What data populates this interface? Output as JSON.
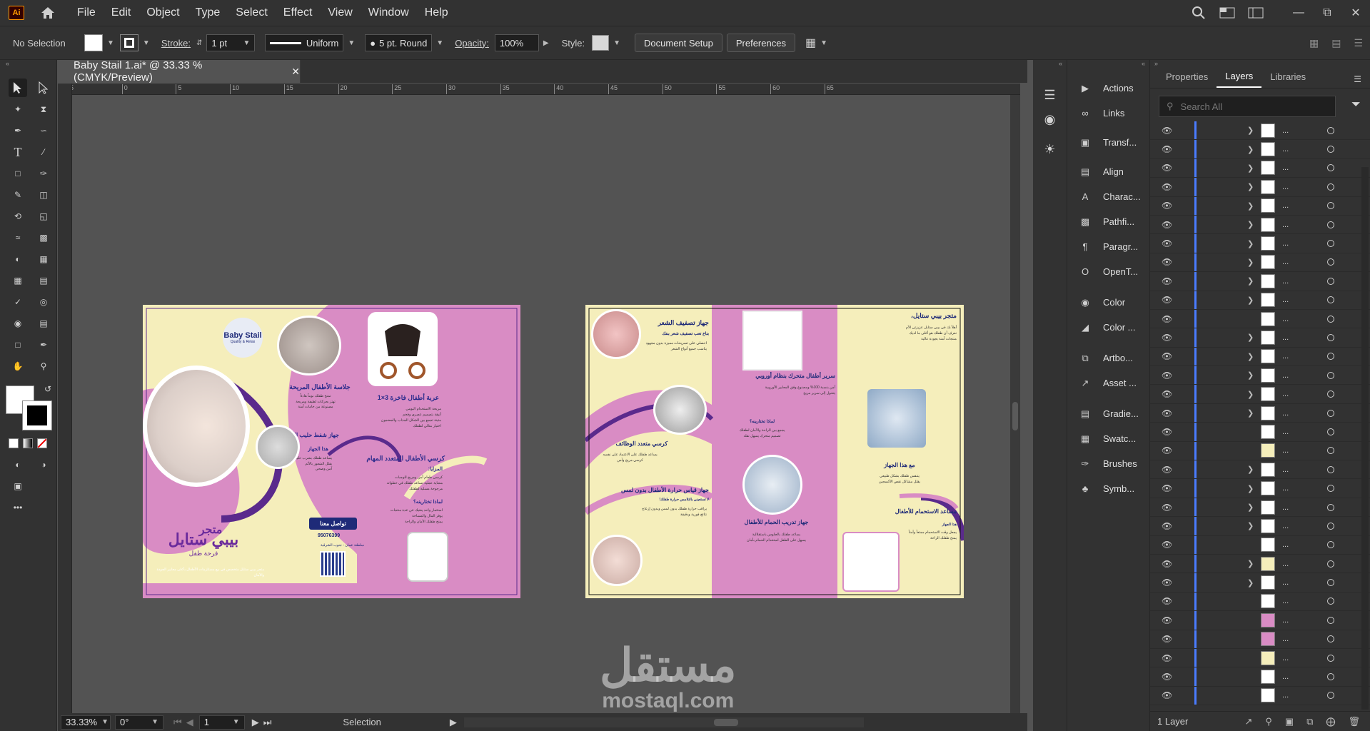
{
  "app": {
    "logo": "Ai"
  },
  "menu": [
    "File",
    "Edit",
    "Object",
    "Type",
    "Select",
    "Effect",
    "View",
    "Window",
    "Help"
  ],
  "control": {
    "selection": "No Selection",
    "stroke_label": "Stroke:",
    "stroke_value": "1 pt",
    "profile": "Uniform",
    "brush": "5 pt. Round",
    "opacity_label": "Opacity:",
    "opacity_value": "100%",
    "style_label": "Style:",
    "doc_setup": "Document Setup",
    "preferences": "Preferences"
  },
  "document": {
    "tab_title": "Baby Stail 1.ai* @ 33.33 % (CMYK/Preview)"
  },
  "ruler": {
    "h_ticks": [
      "5",
      "0",
      "5",
      "10",
      "15",
      "20",
      "25",
      "30",
      "35",
      "40",
      "45",
      "50",
      "55",
      "60",
      "65"
    ]
  },
  "status": {
    "zoom": "33.33%",
    "rotate": "0°",
    "artboard": "1",
    "mode": "Selection"
  },
  "mid_panel": [
    "Actions",
    "Links",
    "Transf...",
    "Align",
    "Charac...",
    "Pathfi...",
    "Paragr...",
    "OpenT...",
    "Color",
    "Color ...",
    "Artbo...",
    "Asset ...",
    "Gradie...",
    "Swatc...",
    "Brushes",
    "Symb..."
  ],
  "layers_panel": {
    "tabs": [
      "Properties",
      "Layers",
      "Libraries"
    ],
    "active_tab": "Layers",
    "search_placeholder": "Search All",
    "row_name": "...",
    "footer": "1 Layer"
  },
  "artboard1": {
    "brand_logo": "Baby Stail",
    "brand_sub": "Quality & Relax",
    "store_title": "متجر",
    "store_name": "بيبي ستايل",
    "store_slogan": "فرحة طفل",
    "s1_title": "جلاسة الأطفال المريحة",
    "s1_text": "تمنح طفلك نوماً هادئاً\nتهتز بحركات لطيفة ومريحة\nمصنوعة من خامات آمنة",
    "s2_title": "عربة أطفال فاخرة 3×1",
    "s2_text": "مريحة الاستخدام اليومي\nأنيقة بتصميم عصري وفخم\nمتينة تجمع بين الشكل الجذاب والمضمون\nاختيار مثالي لطفلك",
    "s3_title": "جهاز شفط حليب الأم الكهربائي:",
    "s3_sub": "هذا الجهاز",
    "s3_text": "يساعد طفلك بشرب حليبك بسهولة\nيقلل الشعور بالألم\nآمن وصحي",
    "s4_title": "كرسي الأطفال المتعدد المهام",
    "s4_sub": "المزايا:",
    "s4_text": "كرسي طعام أمن ومريح للوجبات\nمشاية عملية تساعد طفلك في خطواته\nمرجوحة مسلية لطفلك",
    "s4_why": "لماذا تختارينه؟",
    "s4_why_text": "استثمار واحد يغنيك عن عدة منتجات\nيوفر المال والمساحة\nيمنح طفلك الأمان والراحة",
    "contact_btn": "تواصل معنا",
    "phone": "95076399",
    "address": "سلطنة عمان - جنوب الشرقية",
    "footer_text": "متجر بيبي ستايل متخصص في بيع مستلزمات الأطفال بأعلى معايير الجودة والأمان"
  },
  "artboard2": {
    "p1_title": "جهاز تصفيف الشعر",
    "p1_sub": "بتاع تعب تصفيف شعر بنتك",
    "p1_text": "احصلي على تسريحات مميزة بدون مجهود\nيناسب جميع أنواع الشعر",
    "p2_title": "كرسي متعدد الوظائف",
    "p2_text": "يساعد طفلك على الاعتماد على نفسه\nكرسي مريح وآمن",
    "p3_title": "جهاز قياس حرارة الأطفال بدون لمس",
    "p3_sub": "لا تستعيني بالتلامس حرارة طفلك!",
    "p3_text": "يراقب حرارة طفلك بدون لمس وبدون إزعاج\nنتائج فورية ودقيقة",
    "p4_title": "سرير أطفال متحرك بنظام أوروبي",
    "p4_text": "آمن بنسبة 100% ومصنوع وفق المعايير الأوروبية\nيتحول إلى سرير مريح",
    "p4_why": "لماذا تختارينه؟",
    "p4_why_text": "يجمع بين الراحة والأمان لطفلك\nتصميم متحرك يسهل نقله",
    "p5_title": "جهاز تدريب الحمام للأطفال",
    "p5_text": "يساعد طفلك بالجلوس باستقلالية\nيسهل على الطفل استخدام الحمام بأمان",
    "p6_title": "متجر بيبي ستايل،",
    "p6_text": "أهلاً بك في بيبي ستايل عزيزتي الأم\nنعرف أن طفلك هو أغلى ما لديك\nمنتجات آمنة بجودة عالية",
    "p7_title": "مع هذا الجهاز",
    "p7_text": "يتنفس طفلك بشكل طبيعي\nيقلل مشاكل نقص الأكسجين",
    "p8_title": "مساعد الاستحمام للأطفال",
    "p8_sub": "هذا الجهاز",
    "p8_text": "يجعل وقت الاستحمام ممتعاً وآمناً\nيمنح طفلك الراحة"
  },
  "watermark": {
    "arabic": "مستقل",
    "latin": "mostaql.com"
  },
  "colors": {
    "pink": "#d98cc4",
    "purple": "#5a2a8c",
    "cream": "#f5eebb",
    "navy": "#1e2a78"
  }
}
